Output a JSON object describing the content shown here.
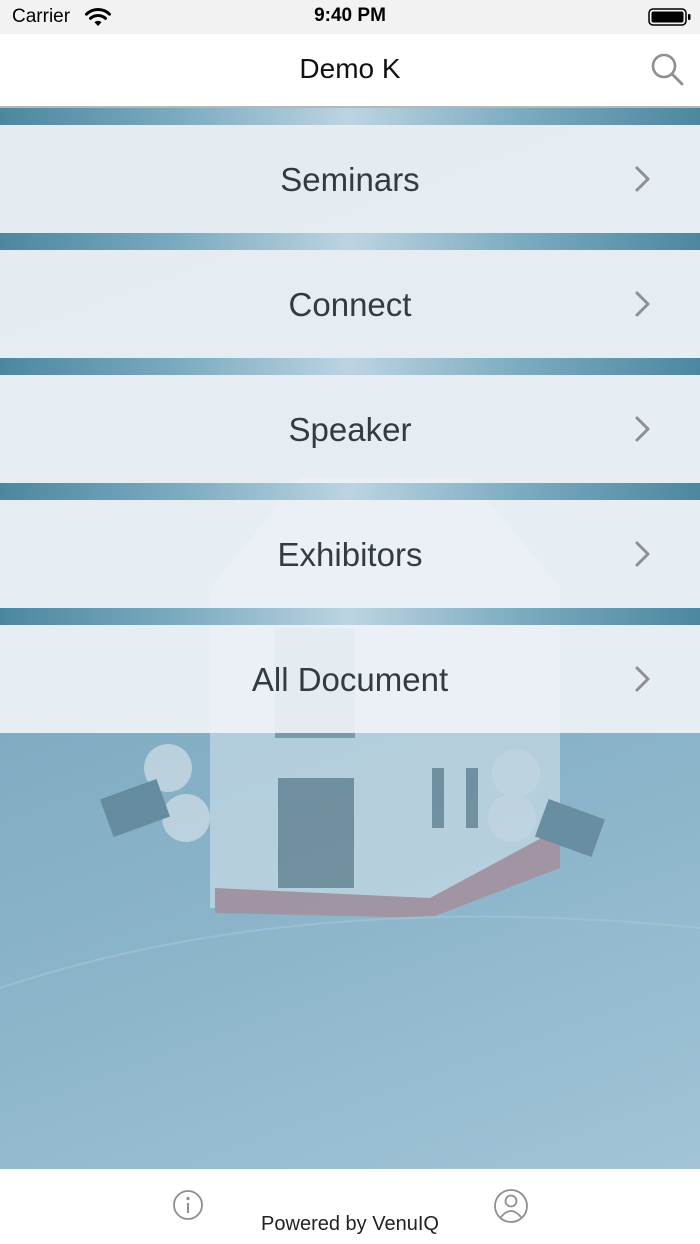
{
  "status_bar": {
    "carrier": "Carrier",
    "time": "9:40 PM",
    "icons": [
      "wifi-icon",
      "battery-icon"
    ]
  },
  "nav": {
    "title": "Demo K",
    "search_icon": "search-icon"
  },
  "menu": {
    "items": [
      {
        "label": "Seminars",
        "icon": "chevron-right-icon"
      },
      {
        "label": "Connect",
        "icon": "chevron-right-icon"
      },
      {
        "label": "Speaker",
        "icon": "chevron-right-icon"
      },
      {
        "label": "Exhibitors",
        "icon": "chevron-right-icon"
      },
      {
        "label": "All Document",
        "icon": "chevron-right-icon"
      }
    ]
  },
  "footer": {
    "powered_by": "Powered by VenuIQ",
    "info_icon": "info-icon",
    "profile_icon": "profile-icon"
  },
  "colors": {
    "background_accent": "#6fa0b8",
    "menu_row": "#eef2f6",
    "text": "#333a40"
  }
}
